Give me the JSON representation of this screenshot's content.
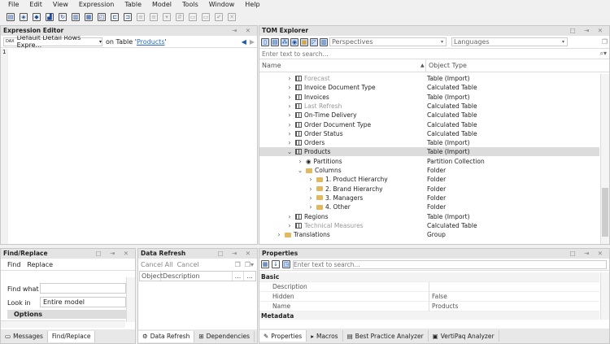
{
  "menu": [
    "File",
    "Edit",
    "View",
    "Expression",
    "Table",
    "Model",
    "Tools",
    "Window",
    "Help"
  ],
  "expression_editor": {
    "title": "Expression Editor",
    "dax_badge": "DAX",
    "selector": "Default Detail Rows Expre...",
    "on_table_prefix": "on Table '",
    "table_link": "Products",
    "on_table_suffix": "'",
    "line_number": "1"
  },
  "tom": {
    "title": "TOM Explorer",
    "perspectives": "Perspectives",
    "languages": "Languages",
    "search_placeholder": "Enter text to search...",
    "col_name": "Name",
    "col_type": "Object Type",
    "rows": [
      {
        "name": "Forecast",
        "type": "Table (Import)",
        "icon": "table",
        "hidden": true,
        "level": 1,
        "exp": ">"
      },
      {
        "name": "Invoice Document Type",
        "type": "Calculated Table",
        "icon": "table",
        "level": 1,
        "exp": ">"
      },
      {
        "name": "Invoices",
        "type": "Table (Import)",
        "icon": "table",
        "level": 1,
        "exp": ">"
      },
      {
        "name": "Last Refresh",
        "type": "Calculated Table",
        "icon": "table",
        "hidden": true,
        "level": 1,
        "exp": ">"
      },
      {
        "name": "On-Time Delivery",
        "type": "Calculated Table",
        "icon": "table",
        "level": 1,
        "exp": ">"
      },
      {
        "name": "Order Document Type",
        "type": "Calculated Table",
        "icon": "table",
        "level": 1,
        "exp": ">"
      },
      {
        "name": "Order Status",
        "type": "Calculated Table",
        "icon": "table",
        "level": 1,
        "exp": ">"
      },
      {
        "name": "Orders",
        "type": "Table (Import)",
        "icon": "table",
        "level": 1,
        "exp": ">"
      },
      {
        "name": "Products",
        "type": "Table (Import)",
        "icon": "table",
        "level": 1,
        "exp": "v",
        "selected": true
      },
      {
        "name": "Partitions",
        "type": "Partition Collection",
        "icon": "partition",
        "level": 2,
        "exp": ">"
      },
      {
        "name": "Columns",
        "type": "Folder",
        "icon": "folder",
        "level": 2,
        "exp": "v"
      },
      {
        "name": "1. Product Hierarchy",
        "type": "Folder",
        "icon": "folder",
        "level": 3,
        "exp": ">"
      },
      {
        "name": "2. Brand Hierarchy",
        "type": "Folder",
        "icon": "folder",
        "level": 3,
        "exp": ">"
      },
      {
        "name": "3. Managers",
        "type": "Folder",
        "icon": "folder",
        "level": 3,
        "exp": ">"
      },
      {
        "name": "4. Other",
        "type": "Folder",
        "icon": "folder",
        "level": 3,
        "exp": ">"
      },
      {
        "name": "Regions",
        "type": "Table (Import)",
        "icon": "table",
        "level": 1,
        "exp": ">"
      },
      {
        "name": "Technical Measures",
        "type": "Calculated Table",
        "icon": "table",
        "hidden": true,
        "level": 1,
        "exp": ">"
      },
      {
        "name": "Translations",
        "type": "Group",
        "icon": "folder",
        "level": 0,
        "exp": ">"
      }
    ]
  },
  "find": {
    "title": "Find/Replace",
    "tab_find": "Find",
    "tab_replace": "Replace",
    "find_what": "Find what",
    "look_in": "Look in",
    "look_in_value": "Entire model",
    "options": "Options",
    "bottom_tabs": [
      "Messages",
      "Find/Replace"
    ]
  },
  "refresh": {
    "title": "Data Refresh",
    "cancel_all": "Cancel All",
    "cancel": "Cancel",
    "col_object": "Object",
    "col_desc": "Description",
    "col_more": "...",
    "bottom_tabs": [
      "Data Refresh",
      "Dependencies"
    ]
  },
  "props": {
    "title": "Properties",
    "search_placeholder": "Enter text to search...",
    "cat_basic": "Basic",
    "rows": [
      {
        "k": "Description",
        "v": ""
      },
      {
        "k": "Hidden",
        "v": "False"
      },
      {
        "k": "Name",
        "v": "Products"
      }
    ],
    "cat_meta": "Metadata",
    "bottom_tabs": [
      "Properties",
      "Macros",
      "Best Practice Analyzer",
      "VertiPaq Analyzer"
    ]
  }
}
